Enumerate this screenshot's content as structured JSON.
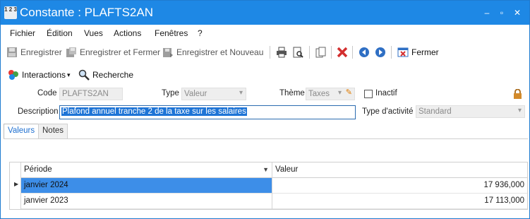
{
  "window": {
    "title": "Constante : PLAFTS2AN",
    "icon_text": "1 2 3"
  },
  "menu": [
    "Fichier",
    "Édition",
    "Vues",
    "Actions",
    "Fenêtres",
    "?"
  ],
  "toolbar": {
    "save_label": "Enregistrer",
    "save_close_label": "Enregistrer et Fermer",
    "save_new_label": "Enregistrer et Nouveau",
    "close_label": "Fermer"
  },
  "toolbar2": {
    "interactions_label": "Interactions",
    "search_label": "Recherche"
  },
  "form": {
    "code_label": "Code",
    "code_value": "PLAFTS2AN",
    "type_label": "Type",
    "type_value": "Valeur",
    "theme_label": "Thème",
    "theme_value": "Taxes",
    "inactive_label": "Inactif",
    "description_label": "Description",
    "description_value": "Plafond annuel tranche 2 de la taxe sur les salaires",
    "activity_type_label": "Type d'activité",
    "activity_type_value": "Standard"
  },
  "tabs": [
    "Valeurs",
    "Notes"
  ],
  "table": {
    "columns": [
      "Période",
      "Valeur"
    ],
    "rows": [
      {
        "period": "janvier 2024",
        "value": "17 936,000"
      },
      {
        "period": "janvier 2023",
        "value": "17 113,000"
      }
    ]
  },
  "colors": {
    "titlebar": "#1e88e5",
    "selection": "#3d8ee8",
    "close_red": "#d32f2f",
    "nav_blue": "#2f6fc4"
  }
}
